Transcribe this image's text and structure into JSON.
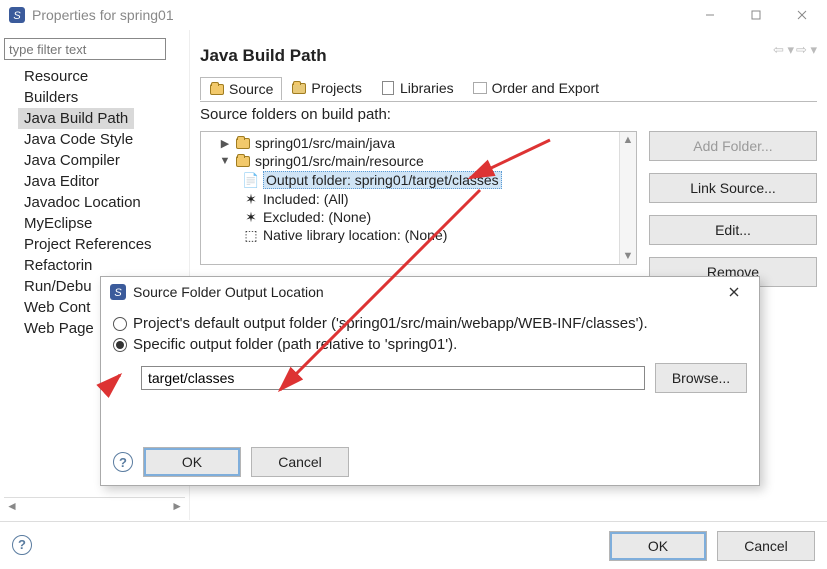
{
  "window": {
    "title": "Properties for spring01"
  },
  "sidebar": {
    "filter_placeholder": "type filter text",
    "items": [
      "Resource",
      "Builders",
      "Java Build Path",
      "Java Code Style",
      "Java Compiler",
      "Java Editor",
      "Javadoc Location",
      "MyEclipse",
      "Project References",
      "Refactorin",
      "Run/Debu",
      "Web Cont",
      "Web Page"
    ],
    "selected_index": 2
  },
  "content": {
    "title": "Java Build Path",
    "tabs": [
      "Source",
      "Projects",
      "Libraries",
      "Order and Export"
    ],
    "active_tab": 0,
    "tree_label": "Source folders on build path:",
    "tree": {
      "n0": "spring01/src/main/java",
      "n1": "spring01/src/main/resource",
      "n1a": "Output folder: spring01/target/classes",
      "n1b": "Included: (All)",
      "n1c": "Excluded: (None)",
      "n1d": "Native library location: (None)"
    },
    "buttons": {
      "add_folder": "Add Folder...",
      "link_source": "Link Source...",
      "edit": "Edit...",
      "remove": "Remove"
    }
  },
  "dialog": {
    "title": "Source Folder Output Location",
    "radio_default": "Project's default output folder ('spring01/src/main/webapp/WEB-INF/classes').",
    "radio_specific": "Specific output folder (path relative to 'spring01').",
    "path_value": "target/classes",
    "browse": "Browse...",
    "ok": "OK",
    "cancel": "Cancel"
  },
  "footer": {
    "ok": "OK",
    "cancel": "Cancel"
  }
}
